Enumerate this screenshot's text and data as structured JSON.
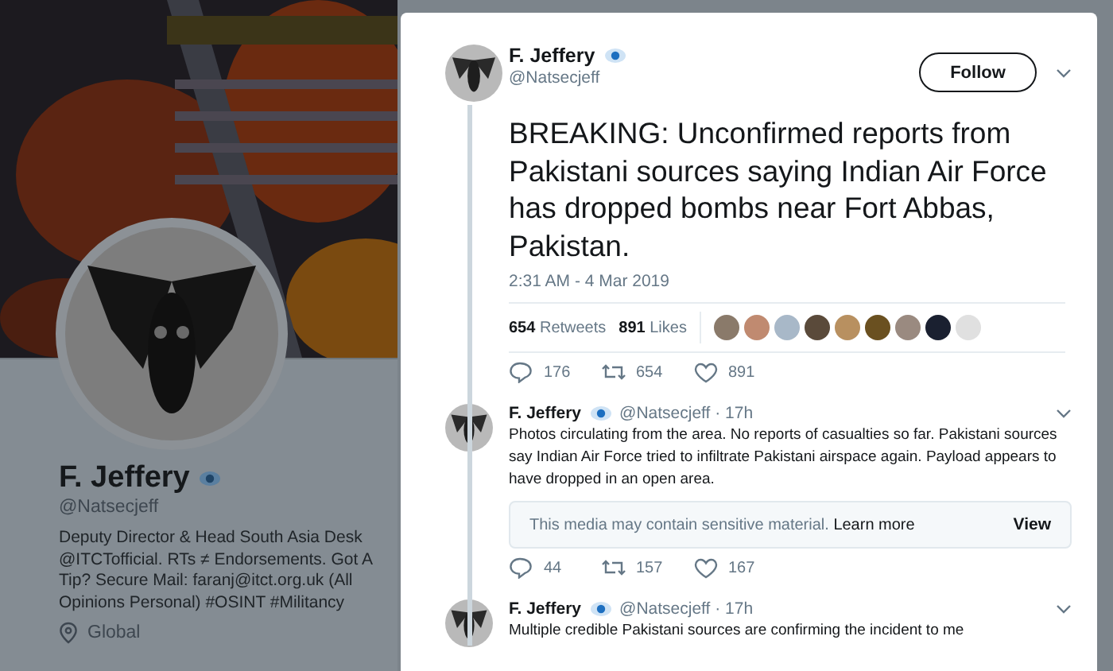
{
  "profile": {
    "name": "F. Jeffery",
    "verified": true,
    "handle": "@Natsecjeff",
    "bio": "Deputy Director & Head South Asia Desk @ITCTofficial. RTs ≠ Endorsements. Got A Tip? Secure Mail: faranj@itct.org.uk (All Opinions Personal) #OSINT #Militancy",
    "location": "Global"
  },
  "tweet": {
    "name": "F. Jeffery",
    "verified": true,
    "handle": "@Natsecjeff",
    "follow_button": "Follow",
    "text": "BREAKING: Unconfirmed reports from Pakistani sources saying Indian Air Force has dropped bombs near Fort Abbas, Pakistan.",
    "timestamp": "2:31 AM - 4 Mar 2019",
    "retweets": {
      "count": "654",
      "label": "Retweets"
    },
    "likes": {
      "count": "891",
      "label": "Likes"
    },
    "liker_avatars": [
      {
        "color": "#8a7a6a"
      },
      {
        "color": "#c08a70"
      },
      {
        "color": "#a8b8c8"
      },
      {
        "color": "#5a4a3a"
      },
      {
        "color": "#b89060"
      },
      {
        "color": "#6a5020"
      },
      {
        "color": "#9a8a80"
      },
      {
        "color": "#1a2030"
      },
      {
        "color": "#e0e0e0"
      }
    ],
    "actions": {
      "replies": "176",
      "retweets": "654",
      "likes": "891"
    }
  },
  "replies": [
    {
      "name": "F. Jeffery",
      "verified": true,
      "byline": "@Natsecjeff · 17h",
      "text": "Photos circulating from the area. No reports of casualties so far. Pakistani sources say Indian Air Force tried to infiltrate Pakistani airspace again. Payload appears to have dropped in an open area.",
      "sensitive_notice": {
        "text": "This media may contain sensitive material.",
        "link": "Learn more",
        "button": "View"
      },
      "actions": {
        "replies": "44",
        "retweets": "157",
        "likes": "167"
      }
    },
    {
      "name": "F. Jeffery",
      "verified": true,
      "byline": "@Natsecjeff · 17h",
      "text": "Multiple credible Pakistani sources are confirming the incident to me"
    }
  ]
}
